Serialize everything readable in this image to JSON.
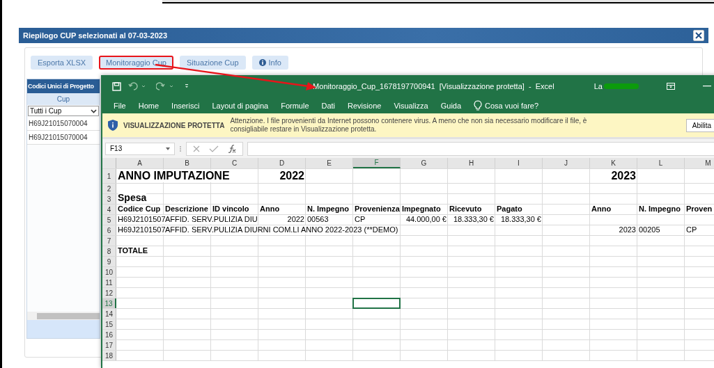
{
  "dialog": {
    "title": "Riepilogo CUP selezionati al 07-03-2023",
    "toolbar": [
      {
        "label": "Esporta XLSX",
        "kind": "plain",
        "highlighted": false
      },
      {
        "label": "Monitoraggio Cup",
        "kind": "plain",
        "highlighted": true
      },
      {
        "label": "Situazione Cup",
        "kind": "plain",
        "highlighted": false
      },
      {
        "label": "Info",
        "kind": "info",
        "highlighted": false
      }
    ],
    "panel": {
      "title": "Codici Unici di Progetto",
      "column": "Cup",
      "filter": "Tutti i Cup",
      "rows": [
        "H69J21015070004",
        "H69J21015070004"
      ]
    }
  },
  "excel": {
    "title": "Monitoraggio_Cup_1678197700941  [Visualizzazione protetta]  -  Excel",
    "user_name": "La",
    "menu": [
      "File",
      "Home",
      "Inserisci",
      "Layout di pagina",
      "Formule",
      "Dati",
      "Revisione",
      "Visualizza",
      "Guida"
    ],
    "tell_me": "Cosa vuoi fare?",
    "protected_bar": {
      "title": "VISUALIZZAZIONE PROTETTA",
      "message": "Attenzione. I file provenienti da Internet possono contenere virus. A meno che non sia necessario modificare il file, è consigliabile restare in Visualizzazione protetta.",
      "button": "Abilita"
    },
    "name_box": "F13",
    "columns": [
      {
        "label": "A",
        "selected": false
      },
      {
        "label": "B",
        "selected": false
      },
      {
        "label": "C",
        "selected": false
      },
      {
        "label": "D",
        "selected": false
      },
      {
        "label": "E",
        "selected": false
      },
      {
        "label": "F",
        "selected": true
      },
      {
        "label": "G",
        "selected": false
      },
      {
        "label": "H",
        "selected": false
      },
      {
        "label": "I",
        "selected": false
      },
      {
        "label": "J",
        "selected": false
      },
      {
        "label": "K",
        "selected": false
      },
      {
        "label": "L",
        "selected": false
      },
      {
        "label": "M",
        "selected": false
      }
    ],
    "rows": [
      {
        "number": "1",
        "selected": false,
        "cells": [
          {
            "text": "ANNO IMPUTAZIONE",
            "kind": "title"
          },
          {},
          {},
          {
            "text": "2022",
            "kind": "title_number"
          },
          {},
          {},
          {},
          {},
          {},
          {},
          {
            "text": "2023",
            "kind": "title_number"
          }
        ]
      },
      {
        "number": "2",
        "selected": false
      },
      {
        "number": "3",
        "selected": false,
        "cells": [
          {
            "text": "Spesa",
            "kind": "section"
          }
        ]
      },
      {
        "number": "4",
        "selected": false,
        "cells": [
          {
            "text": "Codice Cup",
            "kind": "header"
          },
          {
            "text": "Descrizione",
            "kind": "header"
          },
          {
            "text": "ID vincolo",
            "kind": "header"
          },
          {
            "text": "Anno",
            "kind": "header"
          },
          {
            "text": "N. Impegno",
            "kind": "header"
          },
          {
            "text": "Provenienza",
            "kind": "header"
          },
          {
            "text": "Impegnato",
            "kind": "header"
          },
          {
            "text": "Ricevuto",
            "kind": "header"
          },
          {
            "text": "Pagato",
            "kind": "header"
          },
          {},
          {
            "text": "Anno",
            "kind": "header"
          },
          {
            "text": "N. Impegno",
            "kind": "header"
          },
          {
            "text": "Proven",
            "kind": "header"
          }
        ]
      },
      {
        "number": "5",
        "selected": false,
        "cells": [
          {
            "text": "H69J2101507",
            "kind": "text"
          },
          {
            "text": "AFFID. SERV.PULIZIA DIU",
            "kind": "text"
          },
          {},
          {
            "text": "2022",
            "kind": "number"
          },
          {
            "text": "00563",
            "kind": "text"
          },
          {
            "text": "CP",
            "kind": "text"
          },
          {
            "text": "44.000,00 €",
            "kind": "number"
          },
          {
            "text": "18.333,30 €",
            "kind": "number"
          },
          {
            "text": "18.333,30 €",
            "kind": "number"
          }
        ]
      },
      {
        "number": "6",
        "selected": false,
        "cells": [
          {
            "text": "H69J2101507",
            "kind": "text"
          },
          {
            "text": "AFFID. SERV.PULIZIA DIURNI COM.LI ANNO 2022-2023 (**DEMO)",
            "kind": "text"
          },
          {},
          {},
          {},
          {},
          {},
          {},
          {},
          {},
          {
            "text": "2023",
            "kind": "number"
          },
          {
            "text": "00205",
            "kind": "text"
          },
          {
            "text": "CP",
            "kind": "text"
          }
        ]
      },
      {
        "number": "7",
        "selected": false
      },
      {
        "number": "8",
        "selected": false,
        "cells": [
          {
            "text": "TOTALE",
            "kind": "header"
          }
        ]
      },
      {
        "number": "9",
        "selected": false
      },
      {
        "number": "10",
        "selected": false
      },
      {
        "number": "11",
        "selected": false
      },
      {
        "number": "12",
        "selected": false
      },
      {
        "number": "13",
        "selected": true
      },
      {
        "number": "14",
        "selected": false
      },
      {
        "number": "15",
        "selected": false
      },
      {
        "number": "16",
        "selected": false
      },
      {
        "number": "17",
        "selected": false
      },
      {
        "number": "18",
        "selected": false
      }
    ]
  }
}
